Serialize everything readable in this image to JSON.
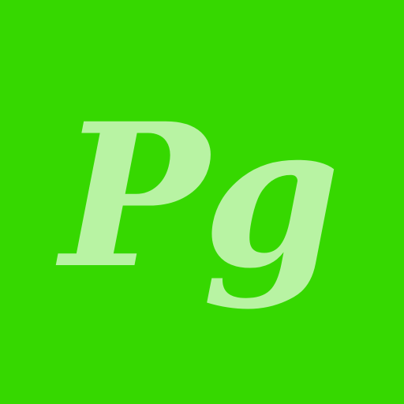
{
  "logo": {
    "text": "Pg"
  },
  "colors": {
    "background": "#36d800",
    "letters": "#b8f3a3"
  }
}
